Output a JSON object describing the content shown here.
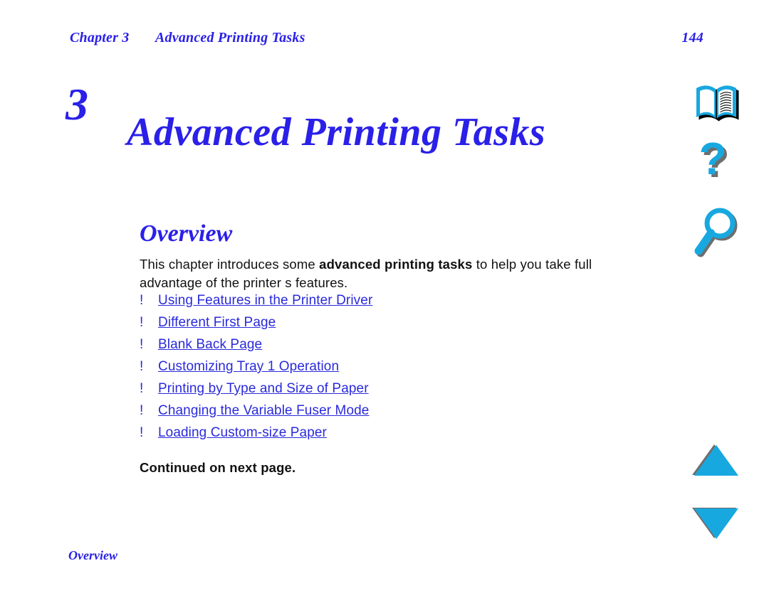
{
  "document": {
    "running_header": {
      "chapter_label": "Chapter 3",
      "chapter_title": "Advanced Printing Tasks",
      "page_number": "144"
    },
    "chapter": {
      "number": "3",
      "title": "Advanced Printing Tasks"
    },
    "section": {
      "heading": "Overview",
      "paragraph": {
        "lead": "This chapter introduces some ",
        "bold": "advanced printing tasks",
        "tail": " to help you take full advantage of the printer s features."
      },
      "continued_note": "Continued on next page."
    },
    "link_list": {
      "bullet_glyph": "!",
      "items": [
        {
          "label": "Using Features in the Printer Driver"
        },
        {
          "label": "Different First Page"
        },
        {
          "label": "Blank Back Page"
        },
        {
          "label": "Customizing Tray 1 Operation"
        },
        {
          "label": "Printing by Type and Size of Paper"
        },
        {
          "label": "Changing the Variable Fuser Mode"
        },
        {
          "label": "Loading Custom-size Paper"
        }
      ]
    },
    "footer": {
      "label": "Overview"
    },
    "icon_rail": {
      "icons": [
        {
          "name": "book-icon",
          "tooltip": "Go to table of contents"
        },
        {
          "name": "question-mark-icon",
          "tooltip": "Help"
        },
        {
          "name": "magnifier-icon",
          "tooltip": "Search"
        },
        {
          "name": "triangle-up-icon",
          "tooltip": "Previous page"
        },
        {
          "name": "triangle-down-icon",
          "tooltip": "Next page"
        }
      ]
    },
    "colors": {
      "heading_blue": "#2A20E8",
      "link_blue": "#2A2ADC",
      "icon_cyan": "#18A8E0",
      "icon_shadow_gray": "#6E6E6E",
      "body_black": "#111111",
      "page_background": "#FFFFFF"
    }
  }
}
